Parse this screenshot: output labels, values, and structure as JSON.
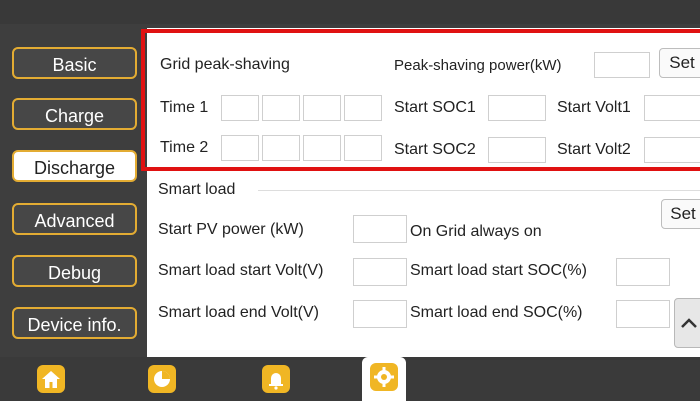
{
  "sidebar": {
    "items": [
      {
        "label": "Basic"
      },
      {
        "label": "Charge"
      },
      {
        "label": "Discharge"
      },
      {
        "label": "Advanced"
      },
      {
        "label": "Debug"
      },
      {
        "label": "Device info."
      }
    ],
    "active": "Discharge"
  },
  "grid_peak": {
    "title": "Grid peak-shaving",
    "power_label": "Peak-shaving power(kW)",
    "set_label": "Set",
    "time1_label": "Time 1",
    "time2_label": "Time 2",
    "start_soc1_label": "Start SOC1",
    "start_soc2_label": "Start SOC2",
    "start_volt1_label": "Start Volt1",
    "start_volt2_label": "Start Volt2"
  },
  "smart_load": {
    "title": "Smart load",
    "set_label": "Set",
    "start_pv_label": "Start PV power (kW)",
    "on_grid_label": "On Grid always on",
    "start_volt_label": "Smart load start Volt(V)",
    "start_soc_label": "Smart load start SOC(%)",
    "end_volt_label": "Smart load end Volt(V)",
    "end_soc_label": "Smart load end SOC(%)"
  },
  "colors": {
    "accent": "#e3ac33",
    "highlight": "#e01111",
    "icon": "#f0b624"
  },
  "nav": {
    "icons": [
      "home-icon",
      "pie-chart-icon",
      "bell-icon",
      "gear-icon"
    ],
    "active": "gear-icon"
  }
}
